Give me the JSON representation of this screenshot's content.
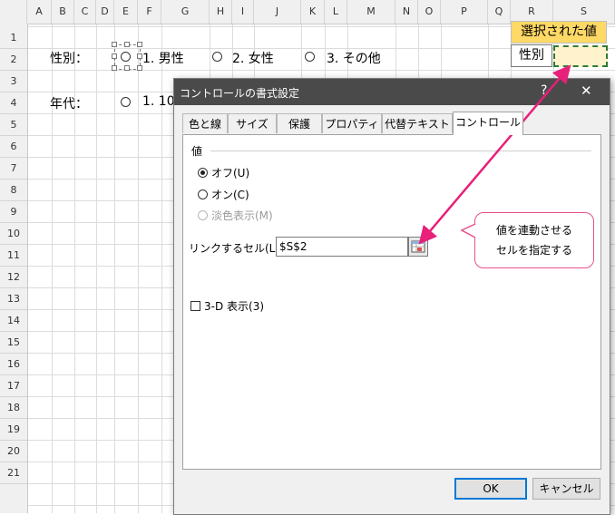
{
  "columns": [
    "A",
    "B",
    "C",
    "D",
    "E",
    "F",
    "G",
    "H",
    "I",
    "J",
    "K",
    "L",
    "M",
    "N",
    "O",
    "P",
    "Q",
    "R",
    "S"
  ],
  "rows": [
    "1",
    "2",
    "3",
    "4",
    "5",
    "6",
    "7",
    "8",
    "9",
    "10",
    "11",
    "12",
    "13",
    "14",
    "15",
    "16",
    "17",
    "18",
    "19",
    "20",
    "21"
  ],
  "sheet": {
    "gender_label": "性別：",
    "age_label": "年代：",
    "options": [
      "1. 男性",
      "2. 女性",
      "3. その他"
    ],
    "age_option_partial": "1. 10",
    "selected_header": "選択された値",
    "r2_label": "性別"
  },
  "dialog": {
    "title": "コントロールの書式設定",
    "help": "?",
    "close": "✕",
    "tabs": [
      "色と線",
      "サイズ",
      "保護",
      "プロパティ",
      "代替テキスト",
      "コントロール"
    ],
    "active_tab": "コントロール",
    "group_label": "値",
    "radio_off": "オフ(U)",
    "radio_on": "オン(C)",
    "radio_mixed": "淡色表示(M)",
    "link_label": "リンクするセル(L):",
    "link_value": "$S$2",
    "checkbox_3d": "3-D 表示(3)",
    "ok": "OK",
    "cancel": "キャンセル"
  },
  "callout": {
    "line1": "値を連動させる",
    "line2": "セルを指定する"
  },
  "colors": {
    "accent": "#e8207a",
    "header_gold": "#ffd966",
    "linked_cell": "#fff2cc",
    "titlebar": "#4a4a4a"
  }
}
